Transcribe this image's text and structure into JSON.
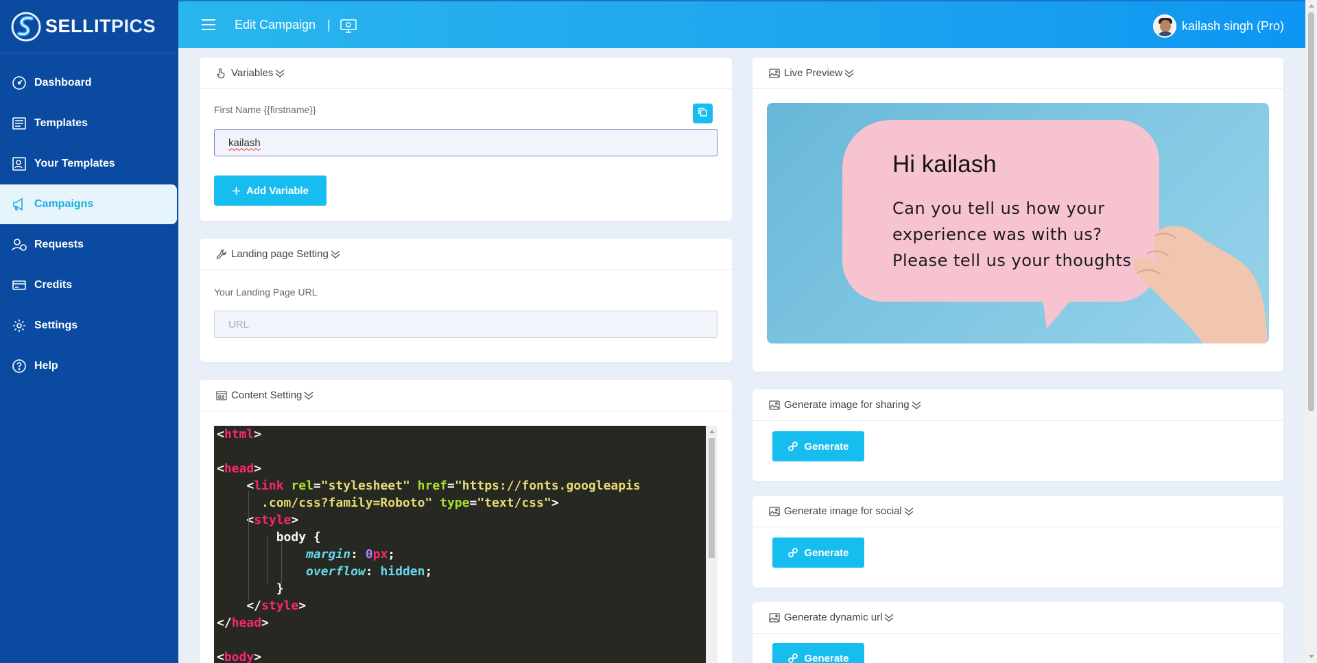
{
  "brand": {
    "name_part1": "SELLIT",
    "name_part2": "PICS"
  },
  "sidebar": {
    "items": [
      {
        "label": "Dashboard",
        "icon": "gauge-icon"
      },
      {
        "label": "Templates",
        "icon": "templates-icon"
      },
      {
        "label": "Your Templates",
        "icon": "your-templates-icon"
      },
      {
        "label": "Campaigns",
        "icon": "megaphone-icon",
        "active": true
      },
      {
        "label": "Requests",
        "icon": "users-icon"
      },
      {
        "label": "Credits",
        "icon": "credit-card-icon"
      },
      {
        "label": "Settings",
        "icon": "gear-icon"
      },
      {
        "label": "Help",
        "icon": "help-icon"
      }
    ]
  },
  "header": {
    "title": "Edit Campaign",
    "separator": "|",
    "user": "kailash singh (Pro)"
  },
  "variables": {
    "title": "Variables",
    "field_label": "First Name {{firstname}}",
    "field_value": "kailash",
    "add_button": "Add Variable"
  },
  "landing": {
    "title": "Landing page Setting",
    "field_label": "Your Landing Page URL",
    "placeholder": "URL"
  },
  "content": {
    "title": "Content Setting",
    "code_lines": [
      "<html>",
      "",
      "<head>",
      "    <link rel=\"stylesheet\" href=\"https://fonts.googleapis",
      "      .com/css?family=Roboto\" type=\"text/css\">",
      "    <style>",
      "        body {",
      "            margin: 0px;",
      "            overflow: hidden;",
      "        }",
      "    </style>",
      "</head>",
      "",
      "<body>"
    ]
  },
  "preview": {
    "title": "Live Preview",
    "heading": "Hi kailash",
    "line1": "Can you tell us how your",
    "line2": "experience was with us?",
    "line3": "Please tell us your thoughts"
  },
  "sharing": {
    "title": "Generate image for sharing",
    "button": "Generate"
  },
  "social": {
    "title": "Generate image for social",
    "button": "Generate"
  },
  "dynamic": {
    "title": "Generate dynamic url",
    "button": "Generate"
  },
  "colors": {
    "sidebar": "#0a4aa0",
    "accent": "#18bdf0",
    "header": "#1ea3ef"
  }
}
